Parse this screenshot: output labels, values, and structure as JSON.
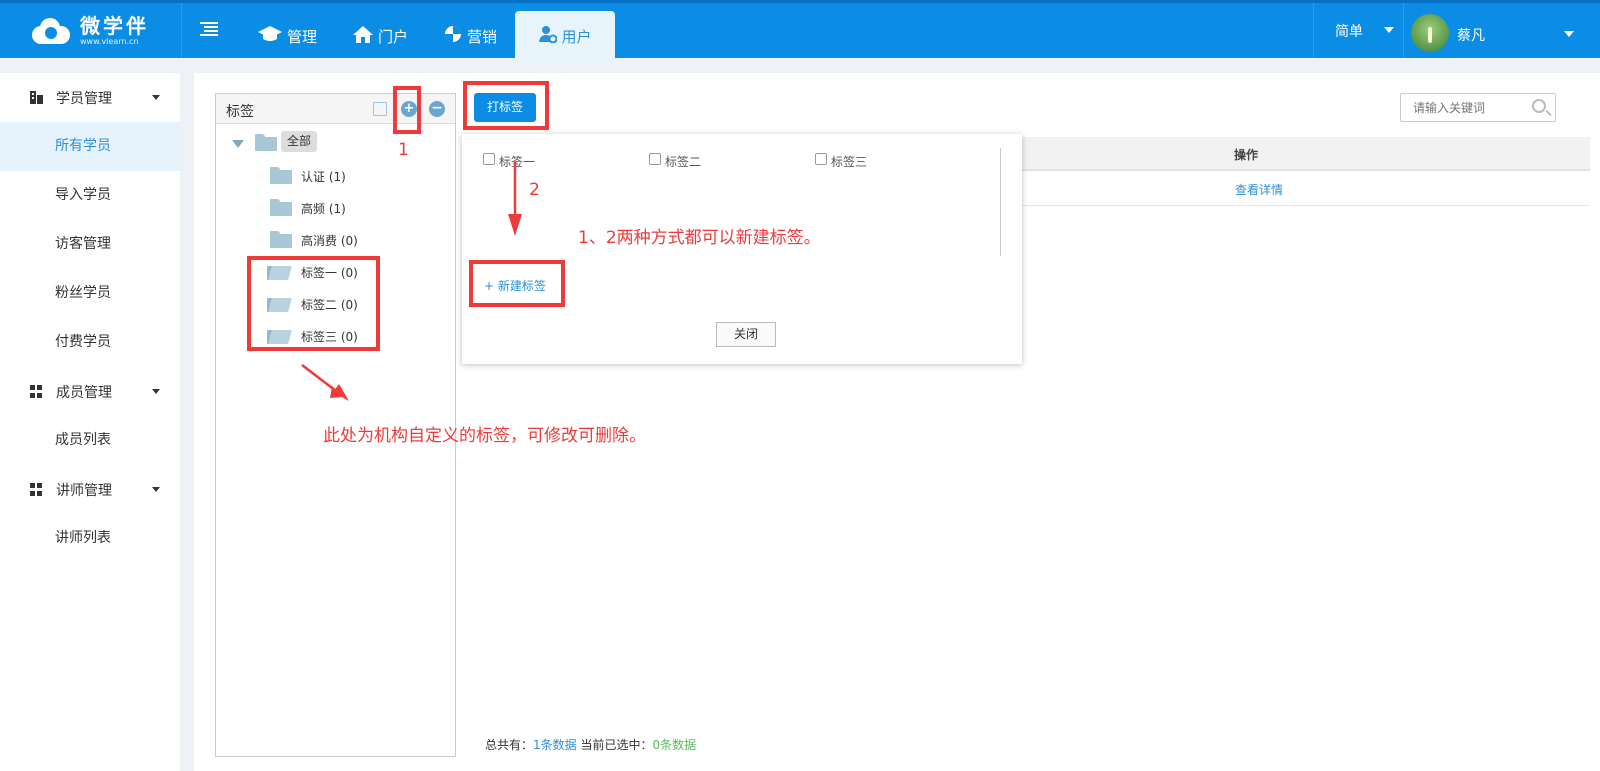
{
  "header": {
    "logo_text": "微学伴",
    "logo_sub": "www.vlearn.cn",
    "nav": [
      {
        "label": "管理",
        "icon": "graduation-cap-icon"
      },
      {
        "label": "门户",
        "icon": "home-icon"
      },
      {
        "label": "营销",
        "icon": "marketing-icon"
      },
      {
        "label": "用户",
        "icon": "user-settings-icon",
        "active": true
      }
    ],
    "mode": "简单",
    "username": "蔡凡"
  },
  "sidebar": {
    "groups": [
      {
        "label": "学员管理",
        "items": [
          "所有学员",
          "导入学员",
          "访客管理",
          "粉丝学员",
          "付费学员"
        ]
      },
      {
        "label": "成员管理",
        "items": [
          "成员列表"
        ]
      },
      {
        "label": "讲师管理",
        "items": [
          "讲师列表"
        ]
      }
    ],
    "active_item": "所有学员"
  },
  "tag_panel": {
    "title": "标签",
    "root": "全部",
    "nodes": [
      "认证 (1)",
      "高频 (1)",
      "高消费 (0)",
      "标签一 (0)",
      "标签二 (0)",
      "标签三 (0)"
    ]
  },
  "toolbar": {
    "tag_button": "打标签",
    "search_placeholder": "请输入关键词"
  },
  "table": {
    "header_op": "操作",
    "row_action": "查看详情"
  },
  "popup": {
    "options": [
      "标签一",
      "标签二",
      "标签三"
    ],
    "new_tag": "+ 新建标签",
    "close": "关闭"
  },
  "footer": {
    "total_prefix": "总共有：",
    "total_value": "1条数据",
    "selected_prefix": " 当前已选中：",
    "selected_value": "0条数据"
  },
  "annotations": {
    "num1": "1",
    "num2": "2",
    "text_methods": "1、2两种方式都可以新建标签。",
    "text_custom": "此处为机构自定义的标签，可修改可删除。"
  },
  "colors": {
    "header_bg": "#0b8de6",
    "accent": "#2d8fd8",
    "annotation": "#f03a3a"
  }
}
